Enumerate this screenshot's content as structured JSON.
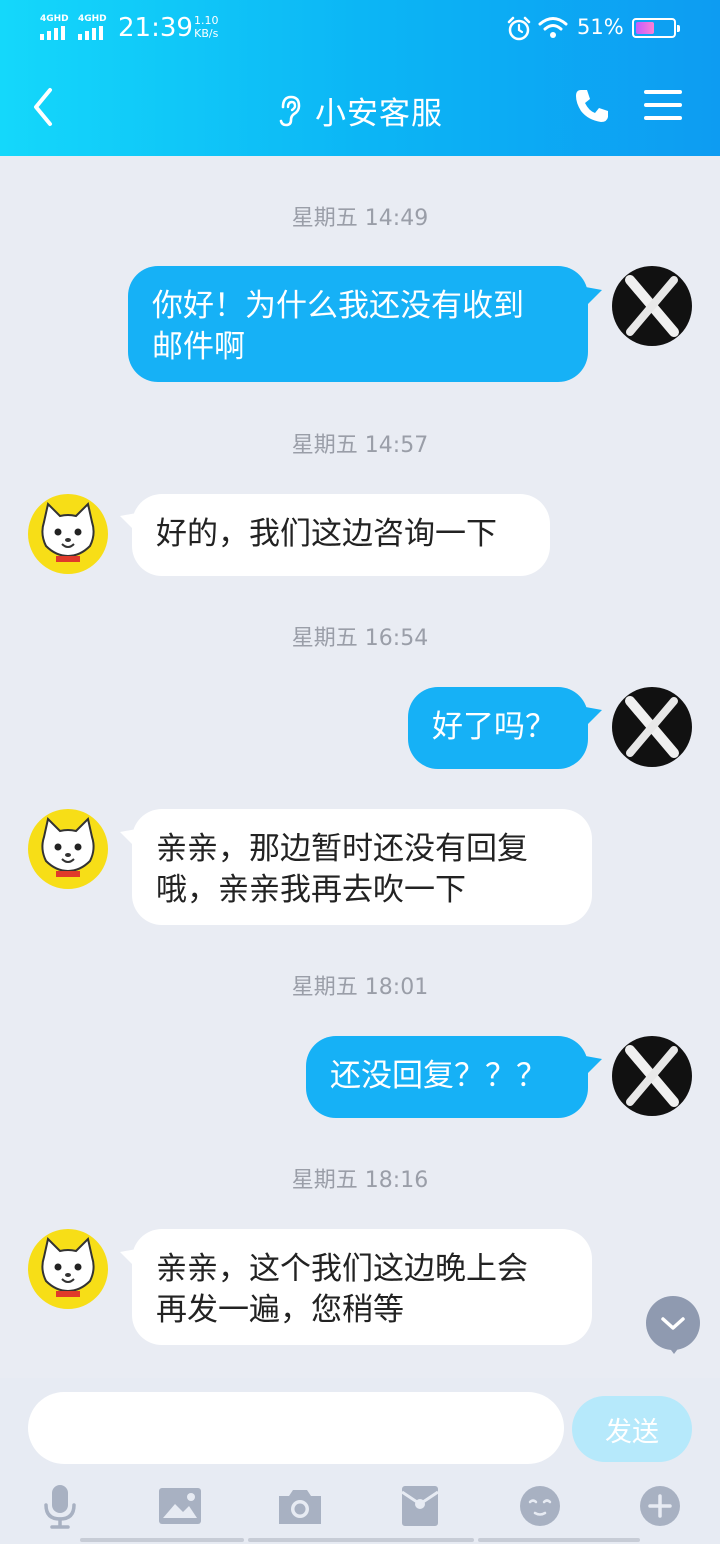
{
  "status_bar": {
    "network_1": "4GHD",
    "network_2": "4GHD",
    "time": "21:39",
    "speed_value": "1.10",
    "speed_unit": "KB/s",
    "battery_percent": "51%",
    "battery_level": 0.51,
    "icons": [
      "signal-icon",
      "alarm-icon",
      "wifi-icon",
      "battery-icon"
    ]
  },
  "nav": {
    "title": "小安客服",
    "icons": [
      "back-icon",
      "ear-icon",
      "phone-icon",
      "menu-icon"
    ]
  },
  "messages": [
    {
      "timestamp": "星期五 14:49",
      "direction": "out",
      "lines": [
        "你好！为什么我还没有收到",
        "邮件啊"
      ]
    },
    {
      "timestamp": "星期五 14:57",
      "direction": "in",
      "lines": [
        "好的，我们这边咨询一下"
      ]
    },
    {
      "timestamp": "星期五 16:54",
      "direction": "out",
      "lines": [
        "好了吗？"
      ]
    },
    {
      "timestamp": "",
      "direction": "in",
      "lines": [
        "亲亲，那边暂时还没有回复",
        "哦，亲亲我再去吹一下"
      ]
    },
    {
      "timestamp": "星期五 18:01",
      "direction": "out",
      "lines": [
        "还没回复？？？"
      ]
    },
    {
      "timestamp": "星期五 18:16",
      "direction": "in",
      "lines": [
        "亲亲，这个我们这边晚上会",
        "再发一遍，您稍等"
      ]
    }
  ],
  "input": {
    "value": "",
    "placeholder": "",
    "send_label": "发送"
  },
  "toolbar": {
    "icons": [
      "microphone-icon",
      "image-icon",
      "camera-icon",
      "red-packet-icon",
      "emoji-icon",
      "plus-icon"
    ]
  },
  "colors": {
    "header_gradient_start": "#14d8fb",
    "header_gradient_end": "#0d9cf2",
    "outgoing_bubble": "#16b1f6",
    "incoming_bubble": "#ffffff",
    "chat_background": "#e9ecf3",
    "send_button": "#b6e9fb"
  }
}
